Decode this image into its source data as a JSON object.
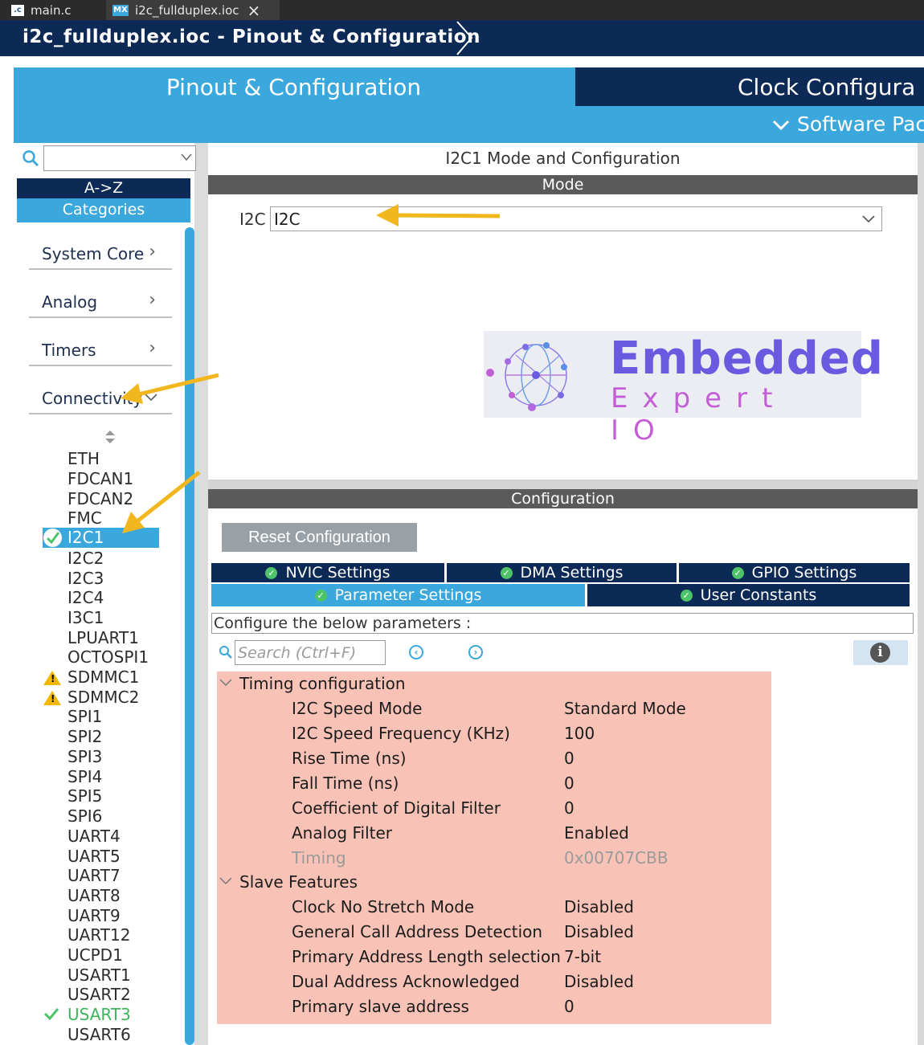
{
  "editor_tabs": [
    {
      "label": "main.c",
      "icon": "c-file-icon"
    },
    {
      "label": "i2c_fullduplex.ioc",
      "icon": "mx-file-icon",
      "close": "×"
    }
  ],
  "title_bar": {
    "title": "i2c_fullduplex.ioc - Pinout & Configuration"
  },
  "header": {
    "tab_pinout": "Pinout & Configuration",
    "tab_clock": "Clock Configura",
    "software_packs": "Software Pac"
  },
  "sidebar": {
    "sort_az": "A->Z",
    "categories": "Categories",
    "groups": [
      "System Core",
      "Analog",
      "Timers",
      "Connectivity"
    ],
    "peripherals": [
      "ETH",
      "FDCAN1",
      "FDCAN2",
      "FMC",
      "I2C1",
      "I2C2",
      "I2C3",
      "I2C4",
      "I3C1",
      "LPUART1",
      "OCTOSPI1",
      "SDMMC1",
      "SDMMC2",
      "SPI1",
      "SPI2",
      "SPI3",
      "SPI4",
      "SPI5",
      "SPI6",
      "UART4",
      "UART5",
      "UART7",
      "UART8",
      "UART9",
      "UART12",
      "UCPD1",
      "USART1",
      "USART2",
      "USART3",
      "USART6"
    ],
    "selected": "I2C1"
  },
  "mode_panel": {
    "title": "I2C1 Mode and Configuration",
    "section": "Mode",
    "i2c_label": "I2C",
    "i2c_value": "I2C"
  },
  "logo": {
    "line1": "Embedded",
    "line2": "Expert IO"
  },
  "config": {
    "section": "Configuration",
    "reset_button": "Reset Configuration",
    "tabs_row1": [
      "NVIC Settings",
      "DMA Settings",
      "GPIO Settings"
    ],
    "tabs_row2": [
      "Parameter Settings",
      "User Constants"
    ],
    "hint": "Configure the below parameters :",
    "search_placeholder": "Search (Ctrl+F)",
    "groups": [
      {
        "name": "Timing configuration",
        "params": [
          {
            "name": "I2C Speed Mode",
            "value": "Standard Mode"
          },
          {
            "name": "I2C Speed Frequency (KHz)",
            "value": "100"
          },
          {
            "name": "Rise Time (ns)",
            "value": "0"
          },
          {
            "name": "Fall Time (ns)",
            "value": "0"
          },
          {
            "name": "Coefficient of Digital Filter",
            "value": "0"
          },
          {
            "name": "Analog Filter",
            "value": "Enabled"
          },
          {
            "name": "Timing",
            "value": "0x00707CBB"
          }
        ]
      },
      {
        "name": "Slave Features",
        "params": [
          {
            "name": "Clock No Stretch Mode",
            "value": "Disabled"
          },
          {
            "name": "General Call Address Detection",
            "value": "Disabled"
          },
          {
            "name": "Primary Address Length selection",
            "value": "7-bit"
          },
          {
            "name": "Dual Address Acknowledged",
            "value": "Disabled"
          },
          {
            "name": "Primary slave address",
            "value": "0"
          }
        ]
      }
    ]
  },
  "colors": {
    "accent": "#3aa7dd",
    "navy": "#0c2a55",
    "highlight": "#f8c3b6",
    "arrow": "#f2b71e",
    "ok": "#4ec46a"
  }
}
